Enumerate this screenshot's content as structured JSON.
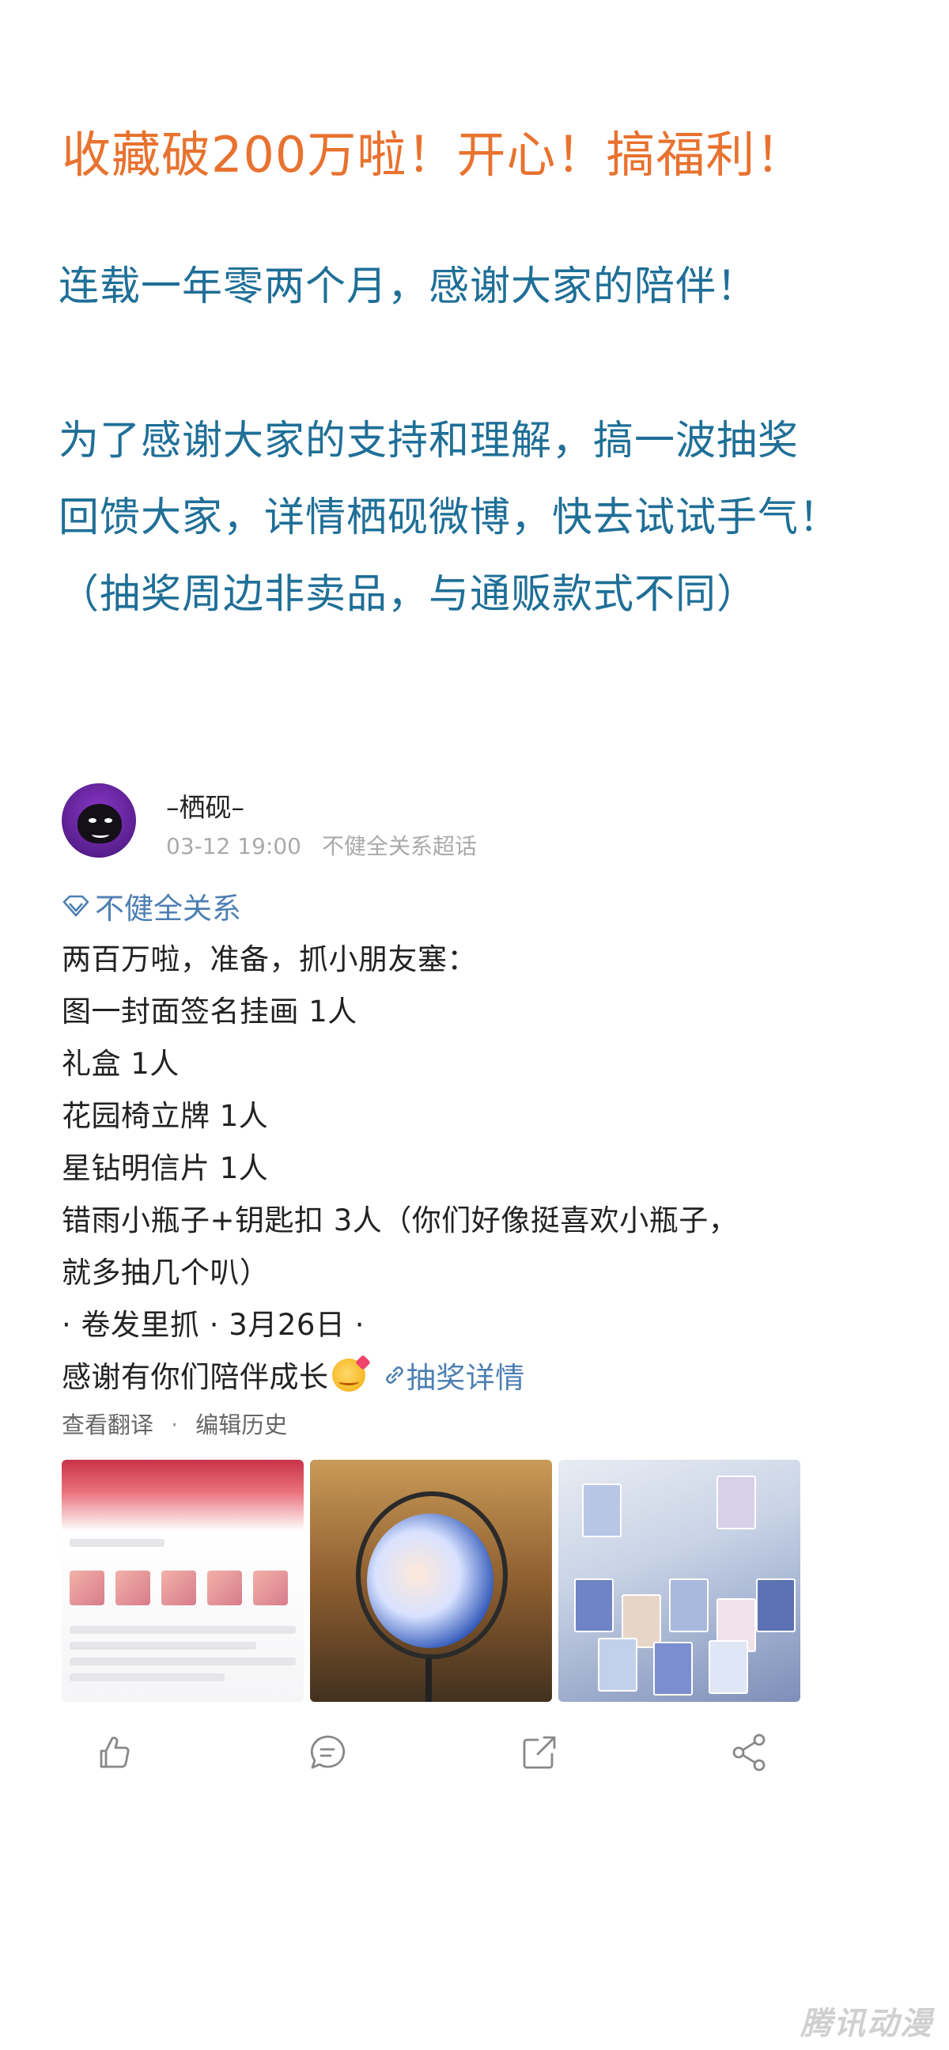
{
  "headline": "收藏破200万啦！开心！搞福利！",
  "intro": {
    "line1": "连载一年零两个月，感谢大家的陪伴！",
    "line2": "为了感谢大家的支持和理解，搞一波抽奖",
    "line3": "回馈大家，详情栖砚微博，快去试试手气！",
    "line4": "（抽奖周边非卖品，与通贩款式不同）"
  },
  "post": {
    "username": "–栖砚–",
    "time": "03-12 19:00",
    "source": "不健全关系超话",
    "topic": "不健全关系",
    "lines": [
      "两百万啦，准备，抓小朋友塞：",
      "图一封面签名挂画 1人",
      "礼盒 1人",
      "花园椅立牌 1人",
      "星钻明信片 1人",
      "错雨小瓶子+钥匙扣 3人（你们好像挺喜欢小瓶子，",
      "就多抽几个叭）",
      "· 卷发里抓 · 3月26日 ·"
    ],
    "last_line": "感谢有你们陪伴成长",
    "link_text": "抽奖详情",
    "translate": "查看翻译",
    "separator": "·",
    "edit_history": "编辑历史"
  },
  "icons": {
    "like": "thumbs-up-icon",
    "comment": "comment-icon",
    "repost": "repost-icon",
    "share": "share-icon"
  },
  "watermark": "腾讯动漫",
  "colors": {
    "headline": "#e8722f",
    "intro": "#1f6f97",
    "link": "#4d7fb3"
  }
}
